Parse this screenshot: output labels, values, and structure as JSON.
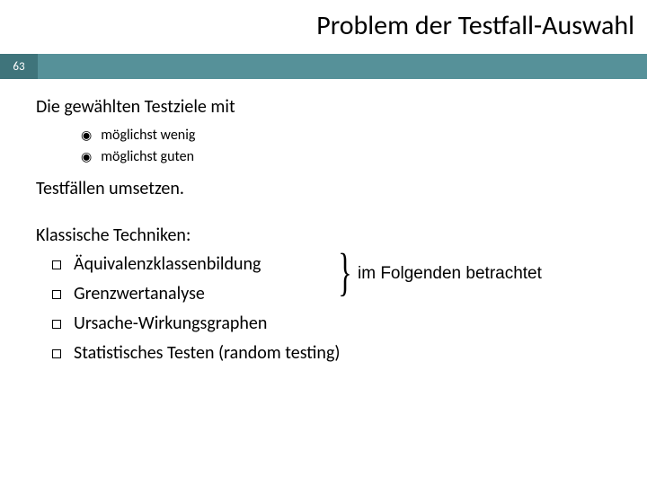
{
  "title": "Problem der Testfall-Auswahl",
  "slideNumber": "63",
  "line1": "Die gewählten Testziele mit",
  "sub": {
    "a": "möglichst wenig",
    "b": "möglichst guten"
  },
  "line2": "Testfällen umsetzen.",
  "sectionHeading": "Klassische Techniken:",
  "tech": {
    "a": "Äquivalenzklassenbildung",
    "b": "Grenzwertanalyse",
    "c": "Ursache-Wirkungsgraphen",
    "d": "Statistisches Testen (random testing)"
  },
  "annotation": "im Folgenden betrachtet"
}
